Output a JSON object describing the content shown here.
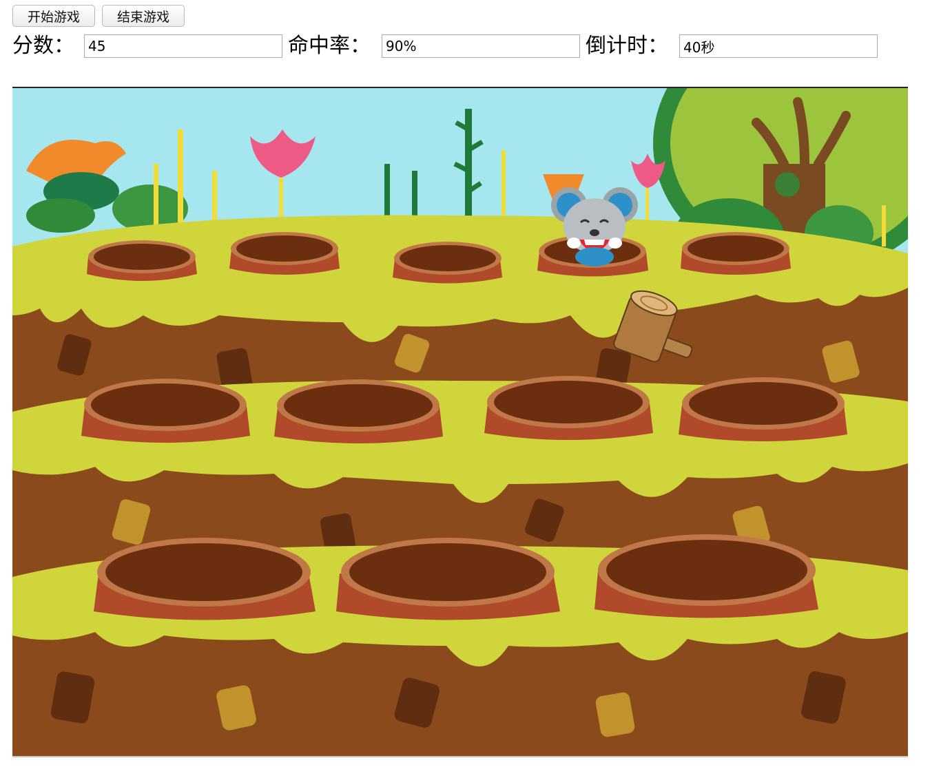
{
  "controls": {
    "start_label": "开始游戏",
    "end_label": "结束游戏"
  },
  "stats": {
    "score_label": "分数：",
    "score_value": "45",
    "accuracy_label": "命中率：",
    "accuracy_value": "90%",
    "countdown_label": "倒计时：",
    "countdown_value": "40秒"
  },
  "game": {
    "mouse_hole_index": 3,
    "hole_count": 12,
    "colors": {
      "sky": "#a6e6ee",
      "grass": "#cfd53a",
      "dirt": "#8b4a1c",
      "hole": "#6b2f10",
      "hole_rim": "#c07848"
    }
  }
}
